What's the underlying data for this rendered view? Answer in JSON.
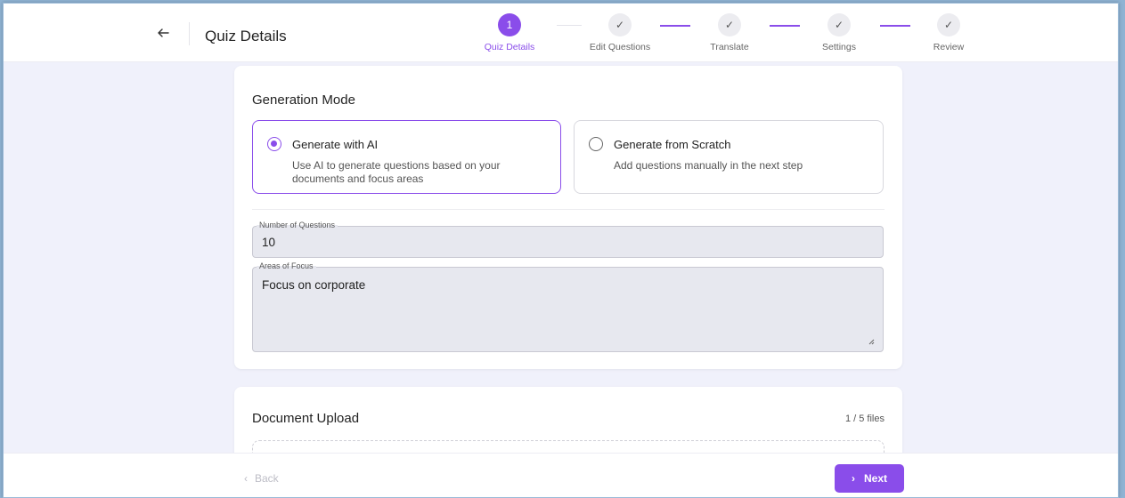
{
  "header": {
    "title": "Quiz Details",
    "steps": [
      {
        "label": "Quiz Details",
        "number": "1",
        "state": "active"
      },
      {
        "label": "Edit Questions",
        "state": "done"
      },
      {
        "label": "Translate",
        "state": "done"
      },
      {
        "label": "Settings",
        "state": "done"
      },
      {
        "label": "Review",
        "state": "done"
      }
    ]
  },
  "generation": {
    "title": "Generation Mode",
    "options": [
      {
        "label": "Generate with AI",
        "description": "Use AI to generate questions based on your documents and focus areas",
        "selected": true
      },
      {
        "label": "Generate from Scratch",
        "description": "Add questions manually in the next step",
        "selected": false
      }
    ],
    "num_questions_label": "Number of Questions",
    "num_questions_value": "10",
    "focus_label": "Areas of Focus",
    "focus_value": "Focus on corporate"
  },
  "upload": {
    "title": "Document Upload",
    "file_count": "1 / 5 files"
  },
  "footer": {
    "back_label": "Back",
    "next_label": "Next"
  },
  "colors": {
    "accent": "#8a4dea",
    "background": "#f0f1fb"
  }
}
